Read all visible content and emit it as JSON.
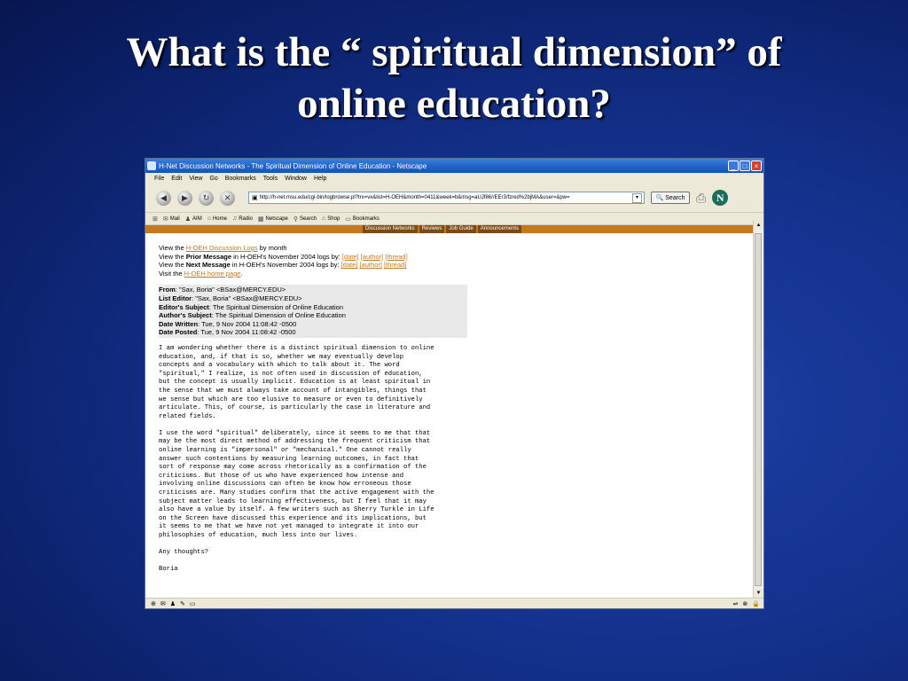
{
  "slide": {
    "title_line1": "What is the “ spiritual dimension” of",
    "title_line2": "online education?"
  },
  "browser": {
    "window_title": "H-Net Discussion Networks - The Spiritual Dimension of Online Education - Netscape",
    "menu": [
      "File",
      "Edit",
      "View",
      "Go",
      "Bookmarks",
      "Tools",
      "Window",
      "Help"
    ],
    "url": "http://h-net.msu.edu/cgi-bin/logbrowse.pl?trx=vx&list=H-OEH&month=0411&week=b&msg=aUJf86//EEr3/fzred%2bjMA&user=&pw=",
    "search_label": "Search",
    "personal_toolbar": [
      "Mail",
      "AIM",
      "Home",
      "Radio",
      "Netscape",
      "Search",
      "Shop",
      "Bookmarks"
    ],
    "banner_tabs": [
      "Discussion Networks",
      "Reviews",
      "Job Guide",
      "Announcements"
    ]
  },
  "page": {
    "line1_pre": "View the ",
    "line1_link": "H-OEH Discussion Logs",
    "line1_post": " by month",
    "line2_pre": "View the ",
    "line2_bold": "Prior Message",
    "line2_post": " in H-OEH's November 2004 logs by: ",
    "line3_pre": "View the ",
    "line3_bold": "Next Message",
    "line3_post": " in H-OEH's November 2004 logs by: ",
    "link_date": "[date]",
    "link_author": "[author]",
    "link_thread": "[thread]",
    "line4_pre": "Visit the ",
    "line4_link": "H-OEH home page",
    "line4_post": ".",
    "header_fields": [
      {
        "label": "From",
        "value": ": \"Sax, Boria\" <BSax@MERCY.EDU>"
      },
      {
        "label": "List Editor",
        "value": ": \"Sax, Boria\" <BSax@MERCY.EDU>"
      },
      {
        "label": "Editor's Subject",
        "value": ": The Spiritual Dimension of Online Education"
      },
      {
        "label": "Author's Subject",
        "value": ": The Spiritual Dimension of Online Education"
      },
      {
        "label": "Date Written",
        "value": ": Tue, 9 Nov 2004 11:08:42 -0500"
      },
      {
        "label": "Date Posted",
        "value": ": Tue, 9 Nov 2004 11:08:42 -0500"
      }
    ],
    "message": "I am wondering whether there is a distinct spiritual dimension to online\neducation, and, if that is so, whether we may eventually develop\nconcepts and a vocabulary with which to talk about it. The word\n\"spiritual,\" I realize, is not often used in discussion of education,\nbut the concept is usually implicit. Education is at least spiritual in\nthe sense that we must always take account of intangibles, things that\nwe sense but which are too elusive to measure or even to definitively\narticulate. This, of course, is particularly the case in literature and\nrelated fields.\n\nI use the word \"spiritual\" deliberately, since it seems to me that that\nmay be the most direct method of addressing the frequent criticism that\nonline learning is \"impersonal\" or \"mechanical.\" One cannot really\nanswer such contentions by measuring learning outcomes, in fact that\nsort of response may come across rhetorically as a confirmation of the\ncriticisms. But those of us who have experienced how intense and\ninvolving online discussions can often be know how erroneous those\ncriticisms are. Many studies confirm that the active engagement with the\nsubject matter leads to learning effectiveness, but I feel that it may\nalso have a value by itself. A few writers such as Sherry Turkle in Life\non the Screen have discussed this experience and its implications, but\nit seems to me that we have not yet managed to integrate it into our\nphilosophies of education, much less into our lives.\n\nAny thoughts?\n\nBoria"
  }
}
